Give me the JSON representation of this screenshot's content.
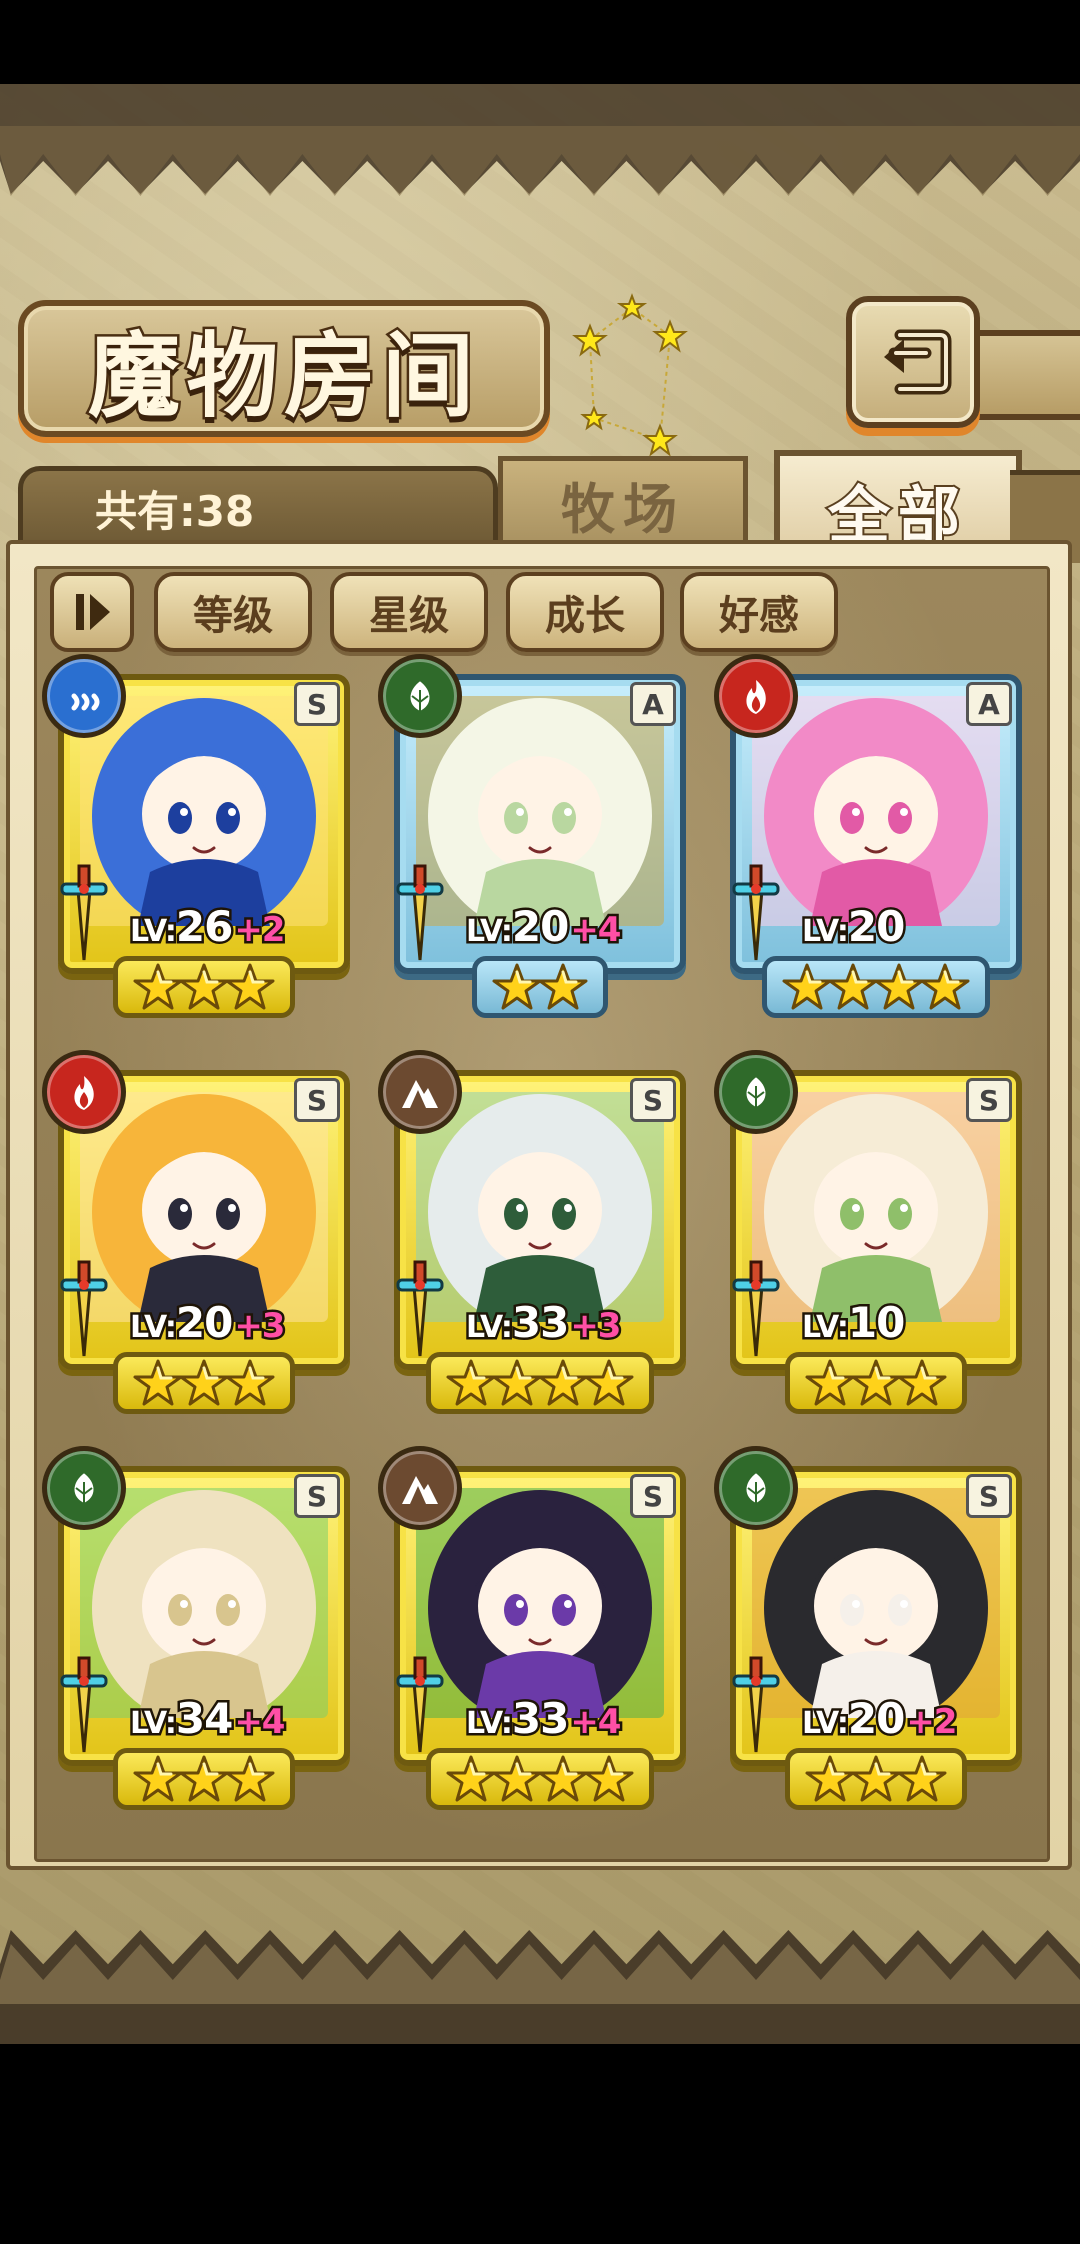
{
  "header": {
    "title": "魔物房间",
    "back_icon": "back-return-icon"
  },
  "tabs": {
    "count_label": "共有:38",
    "ranch": "牧场",
    "all": "全部",
    "active": "全部"
  },
  "sort": {
    "toggle_icon": "sort-order-icon",
    "buttons": [
      "等级",
      "星级",
      "成长",
      "好感"
    ]
  },
  "monsters": [
    {
      "element": "water",
      "rank": "S",
      "level": "26",
      "bonus": "+2",
      "stars": 3,
      "palette": [
        "#3b6fd8",
        "#1d3f9e",
        "#ffe27a"
      ]
    },
    {
      "element": "grass",
      "rank": "A",
      "level": "20",
      "bonus": "+4",
      "stars": 2,
      "palette": [
        "#f4f6e6",
        "#b9d7a0",
        "#caa84a"
      ]
    },
    {
      "element": "fire",
      "rank": "A",
      "level": "20",
      "bonus": "",
      "stars": 4,
      "palette": [
        "#f28ac7",
        "#e25aa6",
        "#ffd0ea"
      ]
    },
    {
      "element": "fire",
      "rank": "S",
      "level": "20",
      "bonus": "+3",
      "stars": 3,
      "palette": [
        "#f7b53a",
        "#2a2a3a",
        "#ffe3a0"
      ]
    },
    {
      "element": "earth",
      "rank": "S",
      "level": "33",
      "bonus": "+3",
      "stars": 4,
      "palette": [
        "#e6ecec",
        "#2e5d3a",
        "#8fd0b0"
      ]
    },
    {
      "element": "grass",
      "rank": "S",
      "level": "10",
      "bonus": "",
      "stars": 3,
      "palette": [
        "#f6ecd6",
        "#8fbf6a",
        "#f4b6c8"
      ]
    },
    {
      "element": "grass",
      "rank": "S",
      "level": "34",
      "bonus": "+4",
      "stars": 3,
      "palette": [
        "#efe2c0",
        "#d8c58e",
        "#7ccf6a"
      ]
    },
    {
      "element": "earth",
      "rank": "S",
      "level": "33",
      "bonus": "+4",
      "stars": 4,
      "palette": [
        "#2a223e",
        "#6b3aa8",
        "#4fb04a"
      ]
    },
    {
      "element": "grass",
      "rank": "S",
      "level": "20",
      "bonus": "+2",
      "stars": 3,
      "palette": [
        "#2a2a2e",
        "#f5f0ea",
        "#e2a23a"
      ]
    }
  ]
}
